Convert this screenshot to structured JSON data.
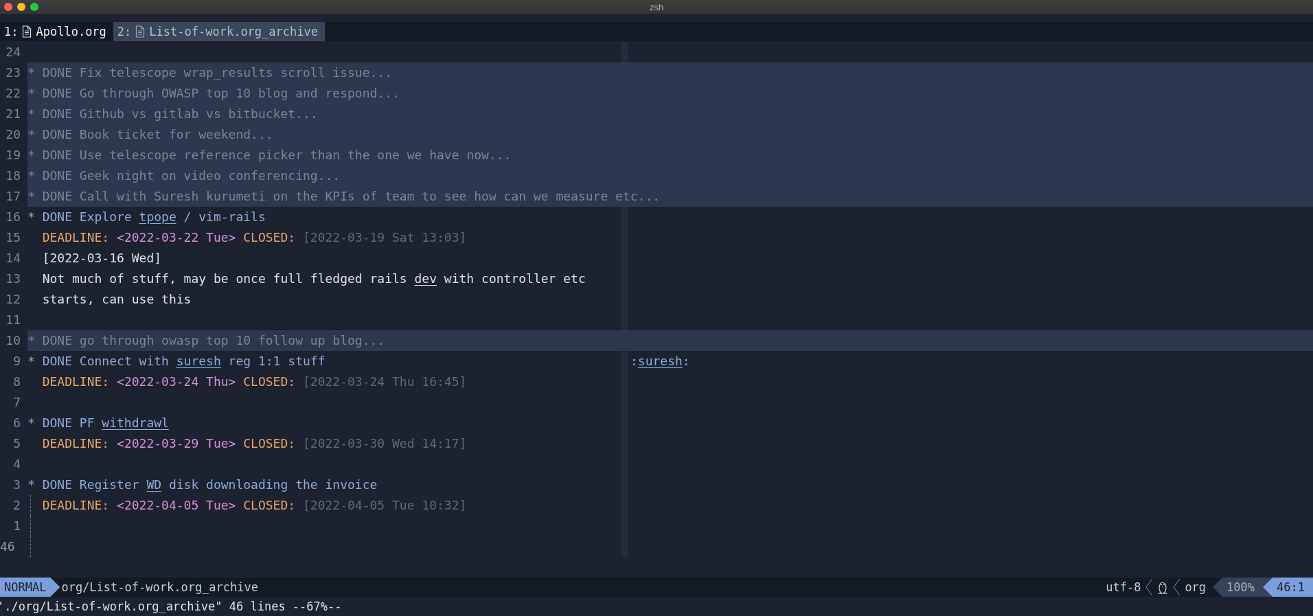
{
  "window": {
    "title": "zsh"
  },
  "tabs": [
    {
      "index": "1:",
      "label": "Apollo.org",
      "selected": false
    },
    {
      "index": "2:",
      "label": "List-of-work.org_archive",
      "selected": true
    }
  ],
  "lines": [
    {
      "number": "24",
      "folded": false,
      "current": false,
      "guide": false
    },
    {
      "number": "23",
      "folded": true,
      "current": false,
      "guide": false,
      "segments": [
        {
          "kind": "folded",
          "text": "* DONE Fix telescope wrap_results scroll issue..."
        }
      ]
    },
    {
      "number": "22",
      "folded": true,
      "current": false,
      "guide": false,
      "segments": [
        {
          "kind": "folded",
          "text": "* DONE Go through OWASP top 10 blog and respond..."
        }
      ]
    },
    {
      "number": "21",
      "folded": true,
      "current": false,
      "guide": false,
      "segments": [
        {
          "kind": "folded",
          "text": "* DONE Github vs gitlab vs bitbucket..."
        }
      ]
    },
    {
      "number": "20",
      "folded": true,
      "current": false,
      "guide": false,
      "segments": [
        {
          "kind": "folded",
          "text": "* DONE Book ticket for weekend..."
        }
      ]
    },
    {
      "number": "19",
      "folded": true,
      "current": false,
      "guide": false,
      "segments": [
        {
          "kind": "folded",
          "text": "* DONE Use telescope reference picker than the one we have now..."
        }
      ]
    },
    {
      "number": "18",
      "folded": true,
      "current": false,
      "guide": false,
      "segments": [
        {
          "kind": "folded",
          "text": "* DONE Geek night on video conferencing..."
        }
      ]
    },
    {
      "number": "17",
      "folded": true,
      "current": false,
      "guide": false,
      "segments": [
        {
          "kind": "folded",
          "text": "* DONE Call with Suresh kurumeti on the KPIs of team to see how can we measure etc..."
        }
      ]
    },
    {
      "number": "16",
      "folded": false,
      "current": false,
      "guide": false,
      "segments": [
        {
          "kind": "bullet",
          "text": "*"
        },
        {
          "kind": "heading",
          "text": "DONE Explore"
        },
        {
          "kind": "link",
          "text": "tpope"
        },
        {
          "kind": "heading",
          "text": "/ vim-rails"
        }
      ]
    },
    {
      "number": "15",
      "folded": false,
      "current": false,
      "guide": false,
      "segments": [
        {
          "kind": "keyword",
          "text": "DEADLINE:"
        },
        {
          "kind": "active-date",
          "text": "<2022-03-22 Tue>"
        },
        {
          "kind": "keyword",
          "text": "CLOSED:"
        },
        {
          "kind": "inactive-date",
          "text": "[2022-03-19 Sat 13:03]"
        }
      ]
    },
    {
      "number": "14",
      "folded": false,
      "current": false,
      "guide": false,
      "segments": [
        {
          "kind": "plain",
          "text": "[2022-03-16 Wed]"
        }
      ]
    },
    {
      "number": "13",
      "folded": false,
      "current": false,
      "guide": false,
      "segments": [
        {
          "kind": "plain",
          "text": "Not much of stuff, may be once full fledged rails"
        },
        {
          "kind": "link",
          "text": "dev"
        },
        {
          "kind": "plain",
          "text": "with controller etc"
        }
      ]
    },
    {
      "number": "12",
      "folded": false,
      "current": false,
      "guide": false,
      "segments": [
        {
          "kind": "plain",
          "text": "starts, can use this"
        }
      ]
    },
    {
      "number": "11",
      "folded": false,
      "current": false,
      "guide": false
    },
    {
      "number": "10",
      "folded": true,
      "current": false,
      "guide": false,
      "segments": [
        {
          "kind": "folded",
          "text": "* DONE go through owasp top 10 follow up blog..."
        }
      ]
    },
    {
      "number": "9",
      "folded": false,
      "current": false,
      "guide": false,
      "segments": [
        {
          "kind": "bullet",
          "text": "*"
        },
        {
          "kind": "heading",
          "text": "DONE Connect with"
        },
        {
          "kind": "link",
          "text": "suresh"
        },
        {
          "kind": "heading",
          "text": "reg 1:1 stuff"
        }
      ],
      "tag": [
        {
          "kind": "colon",
          "text": ":"
        },
        {
          "kind": "link",
          "text": "suresh"
        },
        {
          "kind": "colon",
          "text": ":"
        }
      ]
    },
    {
      "number": "8",
      "folded": false,
      "current": false,
      "guide": false,
      "segments": [
        {
          "kind": "keyword",
          "text": "DEADLINE:"
        },
        {
          "kind": "active-date",
          "text": "<2022-03-24 Thu>"
        },
        {
          "kind": "keyword",
          "text": "CLOSED:"
        },
        {
          "kind": "inactive-date",
          "text": "[2022-03-24 Thu 16:45]"
        }
      ]
    },
    {
      "number": "7",
      "folded": false,
      "current": false,
      "guide": false
    },
    {
      "number": "6",
      "folded": false,
      "current": false,
      "guide": false,
      "segments": [
        {
          "kind": "bullet",
          "text": "*"
        },
        {
          "kind": "heading",
          "text": "DONE PF"
        },
        {
          "kind": "link",
          "text": "withdrawl"
        }
      ]
    },
    {
      "number": "5",
      "folded": false,
      "current": false,
      "guide": false,
      "segments": [
        {
          "kind": "keyword",
          "text": "DEADLINE:"
        },
        {
          "kind": "active-date",
          "text": "<2022-03-29 Tue>"
        },
        {
          "kind": "keyword",
          "text": "CLOSED:"
        },
        {
          "kind": "inactive-date",
          "text": "[2022-03-30 Wed 14:17]"
        }
      ]
    },
    {
      "number": "4",
      "folded": false,
      "current": false,
      "guide": false
    },
    {
      "number": "3",
      "folded": false,
      "current": false,
      "guide": false,
      "segments": [
        {
          "kind": "bullet",
          "text": "*"
        },
        {
          "kind": "heading",
          "text": "DONE Register"
        },
        {
          "kind": "link",
          "text": "WD"
        },
        {
          "kind": "heading",
          "text": "disk downloading the invoice"
        }
      ]
    },
    {
      "number": "2",
      "folded": false,
      "current": false,
      "guide": true,
      "segments": [
        {
          "kind": "keyword",
          "text": "DEADLINE:"
        },
        {
          "kind": "active-date",
          "text": "<2022-04-05 Tue>"
        },
        {
          "kind": "keyword",
          "text": "CLOSED:"
        },
        {
          "kind": "inactive-date",
          "text": "[2022-04-05 Tue 10:32]"
        }
      ]
    },
    {
      "number": "1",
      "folded": false,
      "current": false,
      "guide": true
    },
    {
      "number": "46",
      "folded": false,
      "current": true,
      "guide": true
    }
  ],
  "statusline": {
    "mode": "NORMAL",
    "file": "org/List-of-work.org_archive",
    "encoding": "utf-8",
    "filetype": "org",
    "percent": "100%",
    "position": "46:1"
  },
  "command_line": "'./org/List-of-work.org_archive\" 46 lines --67%--"
}
